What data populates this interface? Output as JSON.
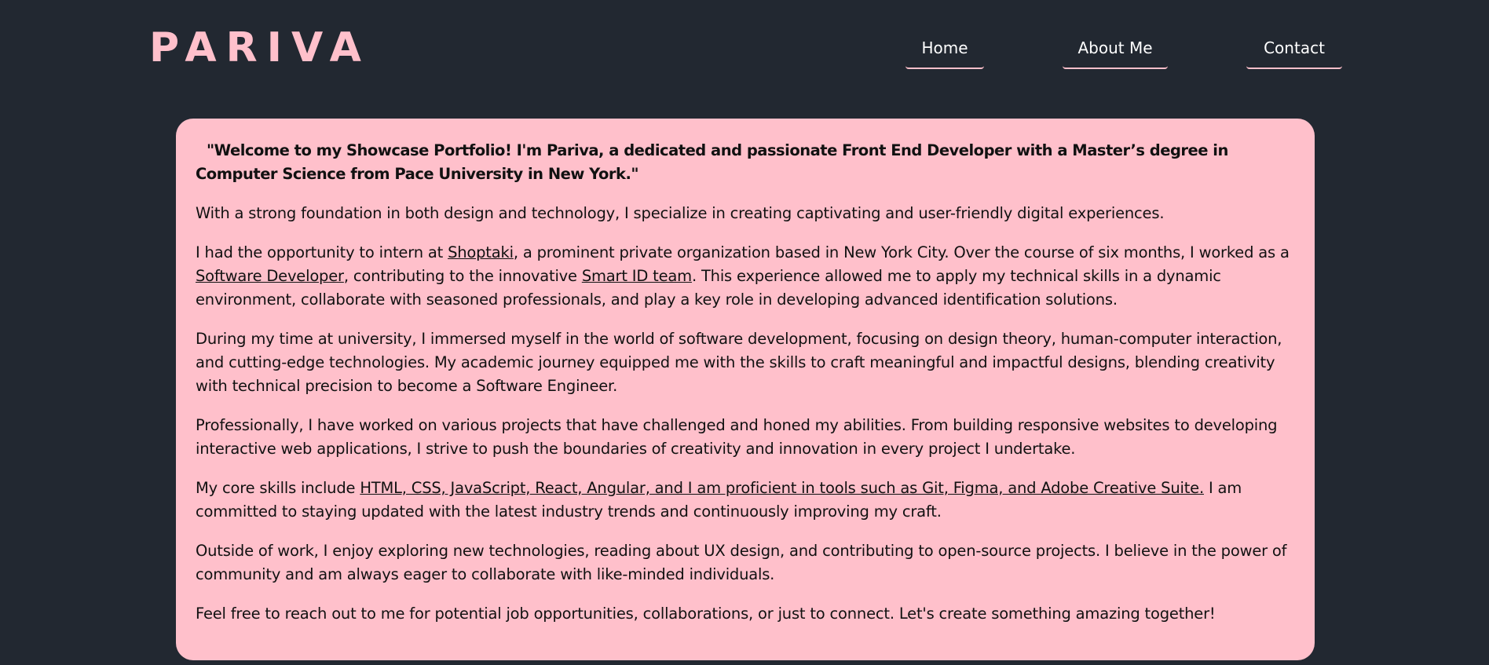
{
  "brand": {
    "logo": "PARIVA",
    "accent_color": "#ffc0cb",
    "background_color": "#222831"
  },
  "nav": {
    "home": "Home",
    "about": "About Me",
    "contact": "Contact"
  },
  "about": {
    "intro": "\"Welcome to my Showcase Portfolio! I'm Pariva, a dedicated and passionate Front End Developer with a Master’s degree in Computer Science from Pace University in New York.\"",
    "p1": "With a strong foundation in both design and technology, I specialize in creating captivating and user-friendly digital experiences.",
    "p2": {
      "t1": "I had the opportunity to intern at ",
      "link_company": "Shoptaki",
      "t2": ", a prominent private organization based in New York City. Over the course of six months, I worked as a ",
      "link_role": "Software Developer",
      "t3": ", contributing to the innovative ",
      "link_team": "Smart ID team",
      "t4": ". This experience allowed me to apply my technical skills in a dynamic environment, collaborate with seasoned professionals, and play a key role in developing advanced identification solutions."
    },
    "p3": "During my time at university, I immersed myself in the world of software development, focusing on design theory, human-computer interaction, and cutting-edge technologies. My academic journey equipped me with the skills to craft meaningful and impactful designs, blending creativity with technical precision to become a Software Engineer.",
    "p4": "Professionally, I have worked on various projects that have challenged and honed my abilities. From building responsive websites to developing interactive web applications, I strive to push the boundaries of creativity and innovation in every project I undertake.",
    "p5": {
      "t1": "My core skills include ",
      "link_skills": "HTML, CSS, JavaScript, React, Angular, and I am proficient in tools such as Git, Figma, and Adobe Creative Suite.",
      "t2": " I am committed to staying updated with the latest industry trends and continuously improving my craft."
    },
    "p6": "Outside of work, I enjoy exploring new technologies, reading about UX design, and contributing to open-source projects. I believe in the power of community and am always eager to collaborate with like-minded individuals.",
    "p7": "Feel free to reach out to me for potential job opportunities, collaborations, or just to connect. Let's create something amazing together!"
  }
}
